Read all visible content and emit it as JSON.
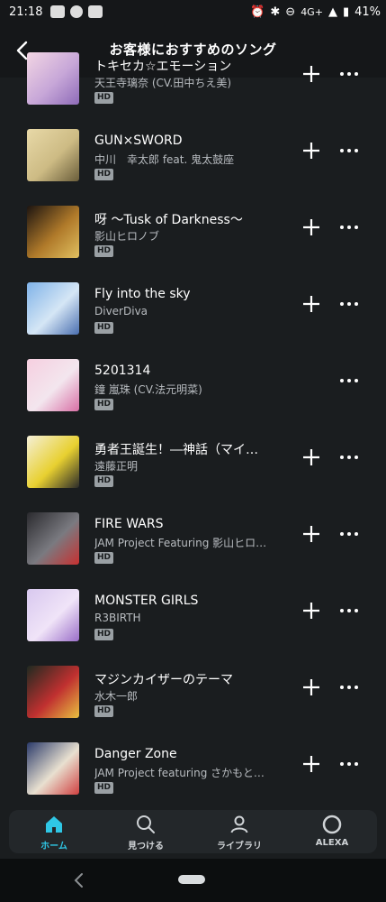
{
  "status_bar": {
    "time": "21:18",
    "network": "4G+",
    "battery": "41%"
  },
  "header": {
    "title": "お客様におすすめのソング"
  },
  "tracks": [
    {
      "title": "トキセカ☆エモーション",
      "artist": "天王寺璃奈 (CV.田中ちえ美)",
      "badge": "HD",
      "add_visible": true,
      "art": [
        "#f3d6e4",
        "#c7a7d8",
        "#8e6bb8"
      ]
    },
    {
      "title": "GUN×SWORD",
      "artist": "中川　幸太郎 feat. 鬼太鼓座",
      "badge": "HD",
      "add_visible": true,
      "art": [
        "#e8d9a8",
        "#cdbb84",
        "#6a5d3a"
      ]
    },
    {
      "title": "呀 〜Tusk of Darkness〜",
      "artist": "影山ヒロノブ",
      "badge": "HD",
      "add_visible": true,
      "art": [
        "#1c1410",
        "#b07a2a",
        "#e0c060"
      ]
    },
    {
      "title": "Fly into the sky",
      "artist": "DiverDiva",
      "badge": "HD",
      "add_visible": true,
      "art": [
        "#7fb2e8",
        "#d5e6f5",
        "#4a6fb0"
      ]
    },
    {
      "title": "5201314",
      "artist": "鐘 嵐珠 (CV.法元明菜)",
      "badge": "HD",
      "add_visible": false,
      "art": [
        "#f6cfe0",
        "#f3e6ee",
        "#d86fa5"
      ]
    },
    {
      "title": "勇者王誕生！―神話（マイ…",
      "artist": "遠藤正明",
      "badge": "HD",
      "add_visible": true,
      "art": [
        "#f5f0d8",
        "#e8d030",
        "#2a2a2a"
      ]
    },
    {
      "title": "FIRE WARS",
      "artist": "JAM Project Featuring 影山ヒロ…",
      "badge": "HD",
      "add_visible": true,
      "art": [
        "#2a2a2e",
        "#7a7a80",
        "#c83030"
      ]
    },
    {
      "title": "MONSTER GIRLS",
      "artist": "R3BIRTH",
      "badge": "HD",
      "add_visible": true,
      "art": [
        "#d8c8ef",
        "#f0e4f8",
        "#9a6ec8"
      ]
    },
    {
      "title": "マジンカイザーのテーマ",
      "artist": "水木一郎",
      "badge": "HD",
      "add_visible": true,
      "art": [
        "#1e2a20",
        "#c03030",
        "#e8c040"
      ]
    },
    {
      "title": "Danger Zone",
      "artist": "JAM Project featuring さかもと…",
      "badge": "HD",
      "add_visible": true,
      "art": [
        "#2a3a6a",
        "#e8e0d0",
        "#d04040"
      ]
    }
  ],
  "bottom_nav": [
    {
      "label": "ホーム",
      "icon": "home-icon",
      "active": true
    },
    {
      "label": "見つける",
      "icon": "search-icon",
      "active": false
    },
    {
      "label": "ライブラリ",
      "icon": "person-icon",
      "active": false
    },
    {
      "label": "ALEXA",
      "icon": "alexa-icon",
      "active": false
    }
  ],
  "colors": {
    "accent": "#2fc7e6",
    "background": "#1a1d1f",
    "nav_background": "#23272a"
  }
}
